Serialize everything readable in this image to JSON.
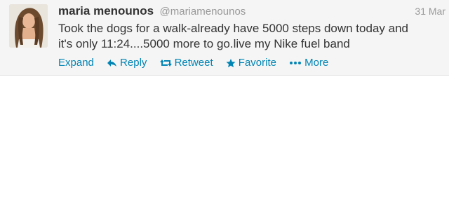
{
  "tweet": {
    "fullname": "maria menounos",
    "username": "@mariamenounos",
    "timestamp": "31 Mar",
    "text_line1": "Took the dogs for a walk-already have 5000 steps down today and",
    "text_line2": "it's only 11:24....5000 more to go.live my Nike fuel band",
    "actions": {
      "expand": "Expand",
      "reply": "Reply",
      "retweet": "Retweet",
      "favorite": "Favorite",
      "more": "More"
    },
    "link_color": "#0084b4"
  },
  "icons": {
    "reply": "reply-arrow-icon",
    "retweet": "retweet-icon",
    "favorite": "star-icon",
    "more": "ellipsis-icon"
  }
}
